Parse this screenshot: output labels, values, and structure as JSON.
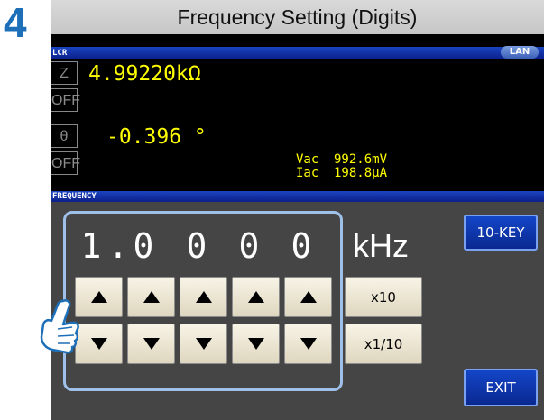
{
  "step_number": "4",
  "title": "Frequency Setting (Digits)",
  "header": {
    "mode_label": "LCR",
    "lan_label": "LAN"
  },
  "params": [
    {
      "name": "Z",
      "value": "4.99220kΩ"
    },
    {
      "name": "OFF"
    },
    {
      "name": "θ",
      "value": "-0.396 °"
    },
    {
      "name": "OFF"
    }
  ],
  "monitor": {
    "vac_label": "Vac",
    "vac_value": "992.6mV",
    "iac_label": "Iac",
    "iac_value": "198.8μA"
  },
  "section_label": "FREQUENCY",
  "digits": [
    "1",
    ".",
    "0",
    "0",
    "0",
    "0"
  ],
  "unit": "kHz",
  "buttons": {
    "x10": "x10",
    "x1_10": "x1/10",
    "tenkey": "10-KEY",
    "exit": "EXIT"
  },
  "colors": {
    "accent": "#1d6fb8",
    "value_yellow": "#ffff00",
    "strip_blue": "#0c1f8a"
  }
}
